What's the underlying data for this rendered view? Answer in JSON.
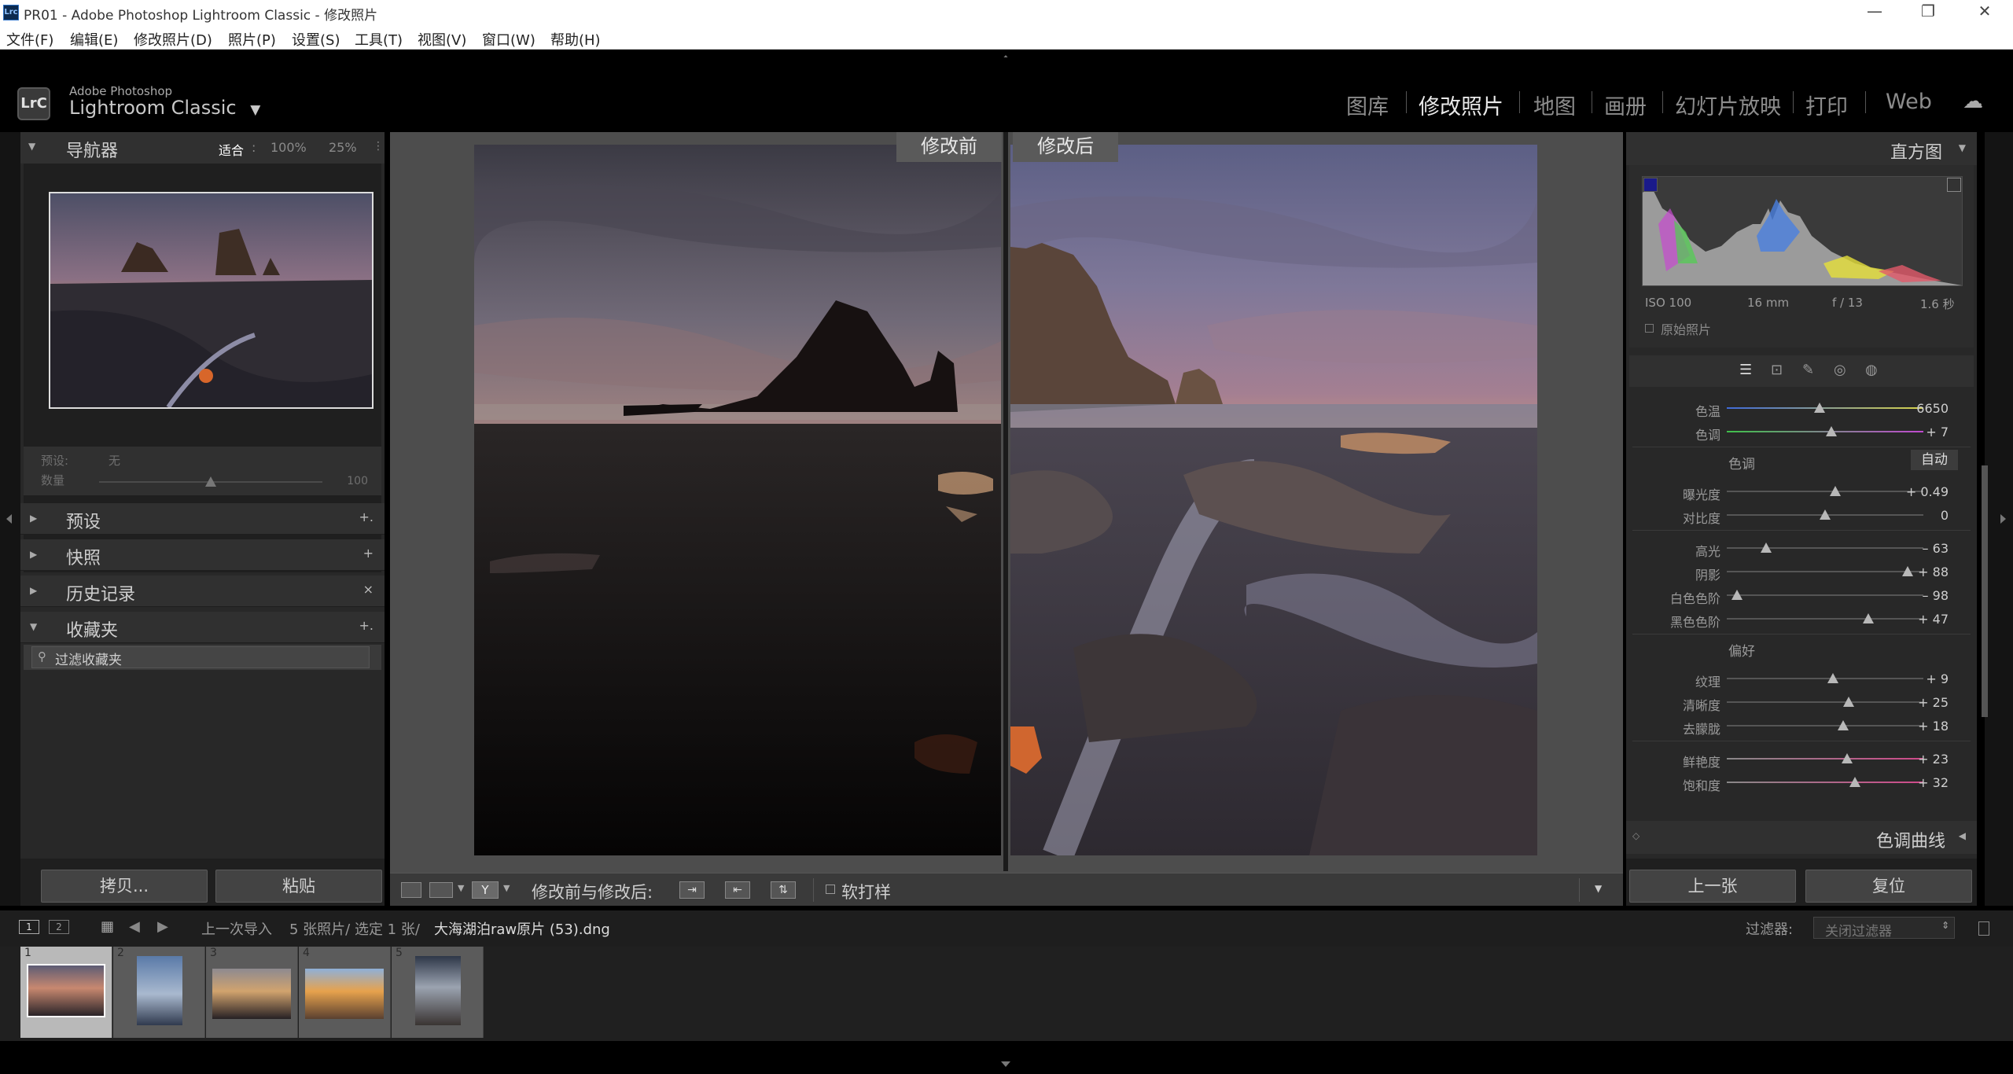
{
  "window": {
    "app_badge": "Lrc",
    "title": "PR01 - Adobe Photoshop Lightroom Classic - 修改照片",
    "controls": [
      "—",
      "❐",
      "✕"
    ]
  },
  "menu": [
    "文件(F)",
    "编辑(E)",
    "修改照片(D)",
    "照片(P)",
    "设置(S)",
    "工具(T)",
    "视图(V)",
    "窗口(W)",
    "帮助(H)"
  ],
  "brand": {
    "logo": "LrC",
    "line1": "Adobe Photoshop",
    "line2": "Lightroom Classic",
    "caret": "▼"
  },
  "modules": [
    "图库",
    "修改照片",
    "地图",
    "画册",
    "幻灯片放映",
    "打印",
    "Web"
  ],
  "active_module": "修改照片",
  "navigator": {
    "title": "导航器",
    "zoom_options": [
      "适合",
      "100%",
      "25%"
    ],
    "zoom_sep": ":",
    "preset_label": "预设:",
    "preset_value": "无",
    "amount_label": "数量",
    "amount_value": "100",
    "amount_level": 0.5
  },
  "left_panels": [
    {
      "label": "预设",
      "action": "+."
    },
    {
      "label": "快照",
      "action": "+"
    },
    {
      "label": "历史记录",
      "action": "×"
    },
    {
      "label": "收藏夹",
      "action": "+."
    }
  ],
  "collections_item": "过滤收藏夹",
  "left_buttons": {
    "copy": "拷贝...",
    "paste": "粘贴"
  },
  "preview_labels": {
    "before": "修改前",
    "after": "修改后"
  },
  "histogram": {
    "title": "直方图",
    "iso": "ISO 100",
    "focal": "16 mm",
    "aperture": "f / 13",
    "shutter": "1.6 秒",
    "original_label": "原始照片"
  },
  "basic": {
    "wb": [
      {
        "name": "色温",
        "value": "6650",
        "level": 0.47
      },
      {
        "name": "色调",
        "value": "+ 7",
        "level": 0.53
      }
    ],
    "tone_label": "色调",
    "auto_label": "自动",
    "tone1": [
      {
        "name": "曝光度",
        "value": "+ 0.49",
        "level": 0.55
      },
      {
        "name": "对比度",
        "value": "0",
        "level": 0.5
      }
    ],
    "tone2": [
      {
        "name": "高光",
        "value": "– 63",
        "level": 0.2
      },
      {
        "name": "阴影",
        "value": "+ 88",
        "level": 0.92
      },
      {
        "name": "白色色阶",
        "value": "– 98",
        "level": 0.05
      },
      {
        "name": "黑色色阶",
        "value": "+ 47",
        "level": 0.72
      }
    ],
    "presence_label": "偏好",
    "presence": [
      {
        "name": "纹理",
        "value": "+ 9",
        "level": 0.54
      },
      {
        "name": "清晰度",
        "value": "+ 25",
        "level": 0.62
      },
      {
        "name": "去朦胧",
        "value": "+ 18",
        "level": 0.59
      }
    ],
    "color": [
      {
        "name": "鲜艳度",
        "value": "+ 23",
        "level": 0.61
      },
      {
        "name": "饱和度",
        "value": "+ 32",
        "level": 0.65
      }
    ],
    "tone_curve_label": "色调曲线"
  },
  "right_buttons": {
    "prev": "上一张",
    "reset": "复位"
  },
  "toolbar": {
    "before_after_label": "修改前与修改后:",
    "soft_proof_label": "软打样"
  },
  "filmstrip_bar": {
    "screen1": "1",
    "screen2": "2",
    "source": "上一次导入",
    "count": "5 张照片/ 选定 1 张/",
    "filename": "大海湖泊raw原片 (53).dng",
    "filter_label": "过滤器:",
    "filter_value": "关闭过滤器"
  },
  "thumbnails": [
    "1",
    "2",
    "3",
    "4",
    "5"
  ],
  "colors": {
    "accent_bg": "#282828",
    "module_active": "#e8e8e8",
    "module_inactive": "#8c8c8c"
  }
}
